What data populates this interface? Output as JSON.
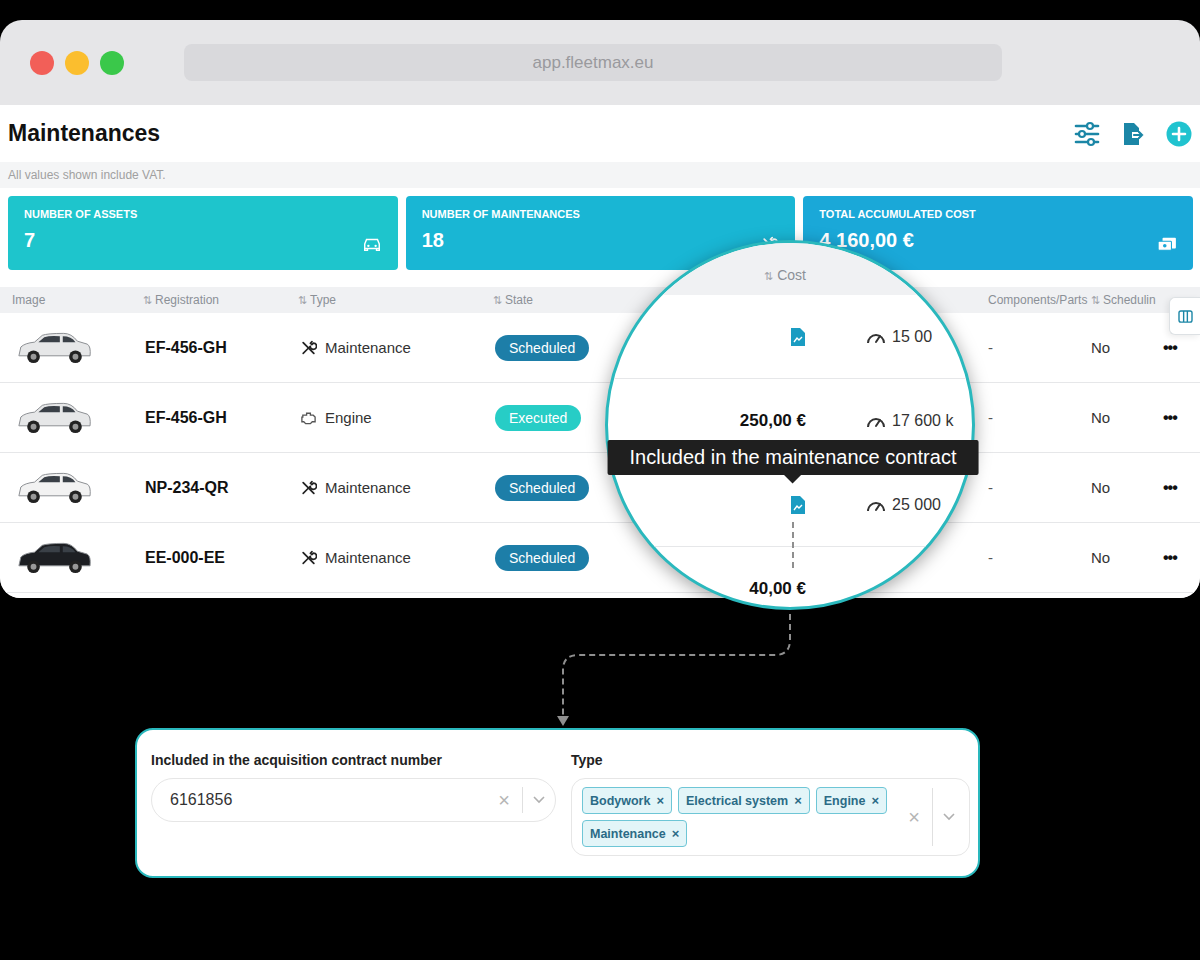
{
  "browser": {
    "url": "app.fleetmax.eu"
  },
  "page": {
    "title": "Maintenances",
    "note": "All values shown include VAT."
  },
  "stats": [
    {
      "label": "NUMBER OF ASSETS",
      "value": "7",
      "kind": "assets",
      "color": "#1ec5cc"
    },
    {
      "label": "NUMBER OF MAINTENANCES",
      "value": "18",
      "kind": "maintenances",
      "color": "#19b6d4"
    },
    {
      "label": "TOTAL ACCUMULATED COST",
      "value": "4 160,00 €",
      "kind": "cost",
      "color": "#1aa8d8"
    }
  ],
  "table": {
    "sort_icon": "⇅",
    "columns": [
      {
        "label": "Image",
        "sortable": false
      },
      {
        "label": "Registration",
        "sortable": true
      },
      {
        "label": "Type",
        "sortable": true
      },
      {
        "label": "State",
        "sortable": true
      },
      {
        "label": "Components/Parts",
        "sortable": false
      },
      {
        "label": "Schedulin",
        "sortable": true
      }
    ],
    "rows": [
      {
        "registration": "EF-456-GH",
        "type": "Maintenance",
        "kind": "maintenance",
        "state": {
          "label": "Scheduled",
          "color": "#1d7ea8"
        },
        "components": "-",
        "scheduling": "No",
        "actions": "•••",
        "car_color": "#e6e7e8"
      },
      {
        "registration": "EF-456-GH",
        "type": "Engine",
        "kind": "engine",
        "state": {
          "label": "Executed",
          "color": "#27cdc6"
        },
        "components": "-",
        "scheduling": "No",
        "actions": "•••",
        "car_color": "#e6e7e8"
      },
      {
        "registration": "NP-234-QR",
        "type": "Maintenance",
        "kind": "maintenance",
        "state": {
          "label": "Scheduled",
          "color": "#1d7ea8"
        },
        "components": "-",
        "scheduling": "No",
        "actions": "•••",
        "car_color": "#f2f2f2"
      },
      {
        "registration": "EE-000-EE",
        "type": "Maintenance",
        "kind": "maintenance",
        "state": {
          "label": "Scheduled",
          "color": "#1d7ea8"
        },
        "components": "-",
        "scheduling": "No",
        "actions": "•••",
        "car_color": "#1d1f23"
      }
    ]
  },
  "magnifier": {
    "column": "Cost",
    "rows": [
      {
        "kind": "contract",
        "mileage": "15 00"
      },
      {
        "kind": "amount",
        "cost": "250,00 €",
        "mileage": "17 600 k"
      },
      {
        "kind": "contract",
        "mileage": "25 000"
      },
      {
        "kind": "amount",
        "cost": "40,00 €"
      }
    ]
  },
  "tooltip": "Included in the maintenance contract",
  "filters": {
    "contract": {
      "label": "Included in the acquisition contract number",
      "value": "6161856",
      "clear_icon": "×"
    },
    "type": {
      "label": "Type",
      "tags": [
        "Bodywork",
        "Electrical system",
        "Engine",
        "Maintenance"
      ],
      "remove_icon": "×",
      "clear_icon": "×"
    }
  }
}
